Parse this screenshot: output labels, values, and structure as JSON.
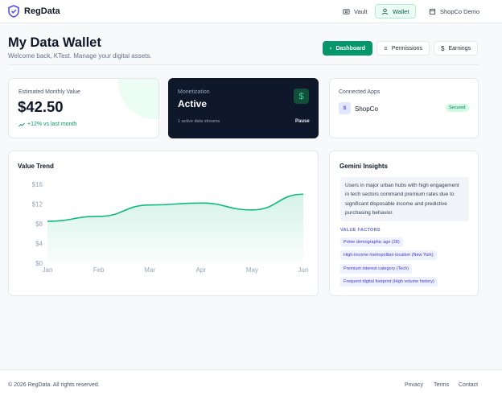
{
  "header": {
    "brand": "RegData",
    "nav": {
      "vault": "Vault",
      "wallet": "Wallet",
      "user": "ShopCo Demo"
    }
  },
  "page": {
    "title": "My Data Wallet",
    "subtitle": "Welcome back, KTest. Manage your digital assets.",
    "tabs": {
      "dashboard": "Dashboard",
      "permissions": "Permissions",
      "earnings": "Earnings"
    }
  },
  "estimate": {
    "label": "Estimated Monthly Value",
    "value": "$42.50",
    "change": "+12% vs last month"
  },
  "monetization": {
    "label": "Monetization",
    "status": "Active",
    "icon": "$",
    "streams": "1 active data streams",
    "pause": "Pause"
  },
  "apps": {
    "label": "Connected Apps",
    "app_initial": "S",
    "app_name": "ShopCo",
    "badge": "Secured"
  },
  "chart_data": {
    "type": "area",
    "title": "Value Trend",
    "categories": [
      "Jan",
      "Feb",
      "Mar",
      "Apr",
      "May",
      "Jun"
    ],
    "series": [
      {
        "values": [
          8.5,
          9.5,
          11.8,
          12.2,
          10.8,
          14.0
        ]
      }
    ],
    "ylim": [
      0,
      16
    ],
    "yticks": [
      0,
      4,
      8,
      12,
      16
    ],
    "ytick_labels": [
      "$0",
      "$4",
      "$8",
      "$12",
      "$16"
    ],
    "color": "#10b981"
  },
  "insights": {
    "title": "Gemini Insights",
    "text": "Users in major urban hubs with high engagement in tech sectors command premium rates due to significant disposable income and predictive purchasing behavior.",
    "factors_label": "VALUE FACTORS",
    "factors": [
      "Prime demographic age (28)",
      "High-income metropolitan location (New York)",
      "Premium interest category (Tech)",
      "Frequent digital footprint (High volume history)"
    ]
  },
  "footer": {
    "copyright": "© 2026 RegData. All rights reserved.",
    "privacy": "Privacy",
    "terms": "Terms",
    "contact": "Contact"
  },
  "colors": {
    "accent": "#059669",
    "dark_card": "#0f172a",
    "factor_bg": "#eef2ff"
  }
}
